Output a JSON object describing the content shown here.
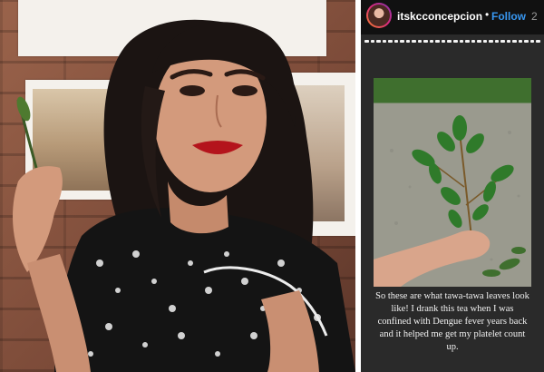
{
  "post": {
    "username": "itskcconcepcion",
    "separator": "•",
    "follow_label": "Follow",
    "time": "2",
    "progress_segments": 30,
    "progress_completed": 30
  },
  "caption": "So these are what tawa-tawa leaves look like! I drank this tea when I was confined with Dengue fever years back and it helped me get my platelet count up.",
  "icons": {
    "avatar": "profile-avatar",
    "story-ring": "gradient-ring"
  },
  "colors": {
    "follow": "#3897f0",
    "header_bg": "#111111",
    "story_bg": "#2a2a2a"
  }
}
